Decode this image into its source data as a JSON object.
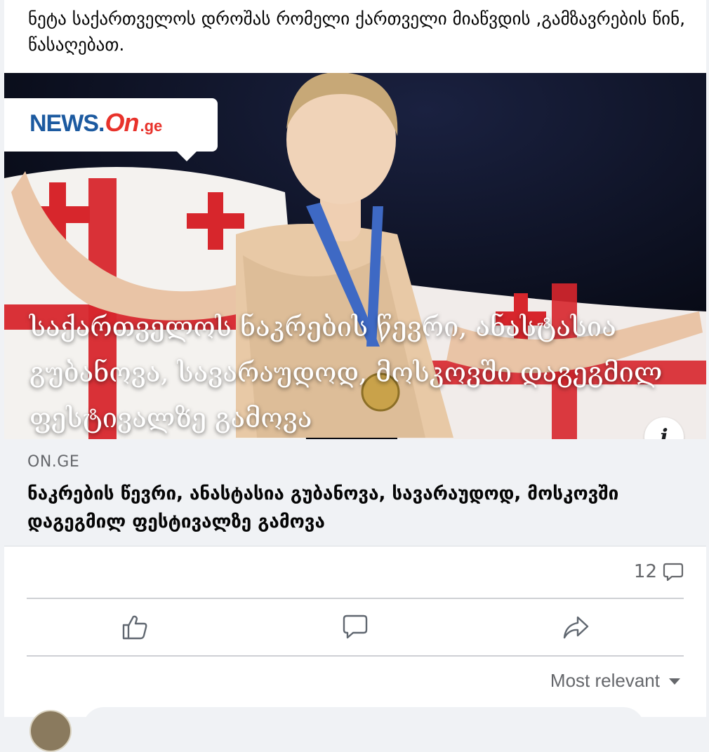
{
  "post": {
    "text": "ნეტა საქართველოს დროშას რომელი ქართველი მიაწვდის ,გამზავრების წინ, წასაღებათ."
  },
  "media": {
    "logo": {
      "news": "NEWS",
      "dot": ".",
      "on": "On",
      "ge": ".ge"
    },
    "headline": "საქართველოს ნაკრების წევრი, ანასტასია გუბანოვა, სავარაუდოდ, მოსკოვში დაგეგმილ ფესტივალზე გამოვა",
    "info_icon": "i"
  },
  "link": {
    "source": "ON.GE",
    "title": "ნაკრების წევრი, ანასტასია გუბანოვა, სავარაუდოდ, მოსკოვში დაგეგმილ ფესტივალზე გამოვა"
  },
  "stats": {
    "comments": "12"
  },
  "actions": {
    "like_icon": "thumbs-up-icon",
    "comment_icon": "comment-icon",
    "share_icon": "share-icon"
  },
  "comments": {
    "sort_label": "Most relevant"
  },
  "colors": {
    "brand_blue": "#1c5aa0",
    "brand_red": "#e8322b",
    "muted": "#65676b"
  }
}
